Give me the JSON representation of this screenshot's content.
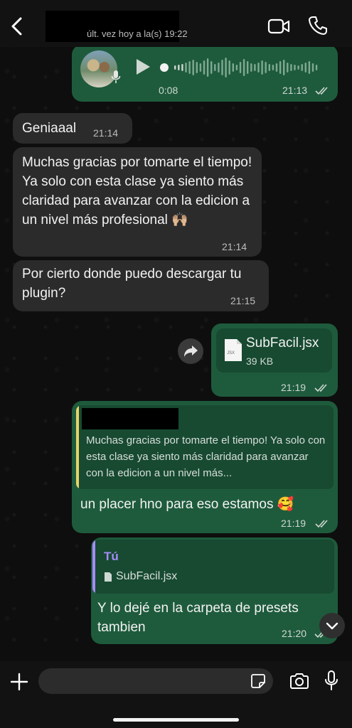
{
  "header": {
    "status": "últ. vez hoy a la(s) 19:22"
  },
  "voice_message": {
    "duration": "0:08",
    "time": "21:13",
    "progress": 0.0
  },
  "messages": [
    {
      "text": "Geniaaal",
      "time": "21:14"
    },
    {
      "text": "Muchas gracias por tomarte el tiempo! Ya solo con esta clase ya siento más claridad para avanzar con la edicion a un nivel más profesional 🙌🏼",
      "time": "21:14"
    },
    {
      "text": "Por cierto donde puedo descargar tu plugin?",
      "time": "21:15"
    }
  ],
  "file_message": {
    "filename": "SubFacil.jsx",
    "size": "39 KB",
    "icon_label": "JSX",
    "time": "21:19"
  },
  "reply1": {
    "quoted": "Muchas gracias por tomarte el tiempo! Ya solo con esta clase ya siento más claridad para avanzar con la edicion a un nivel más...",
    "text": "un placer hno para eso estamos 🥰",
    "time": "21:19",
    "quote_bar_color": "#e5d36b"
  },
  "reply2": {
    "quoted_author": "Tú",
    "quoted_file": "SubFacil.jsx",
    "text": "Y lo dejé en la carpeta de presets tambien",
    "time": "21:20",
    "quote_bar_color": "#a78bfa"
  },
  "composer": {
    "placeholder": ""
  },
  "colors": {
    "incoming": "#2b2b2b",
    "outgoing": "#1e5b3c",
    "read_ticks": "#cfd8d2"
  }
}
